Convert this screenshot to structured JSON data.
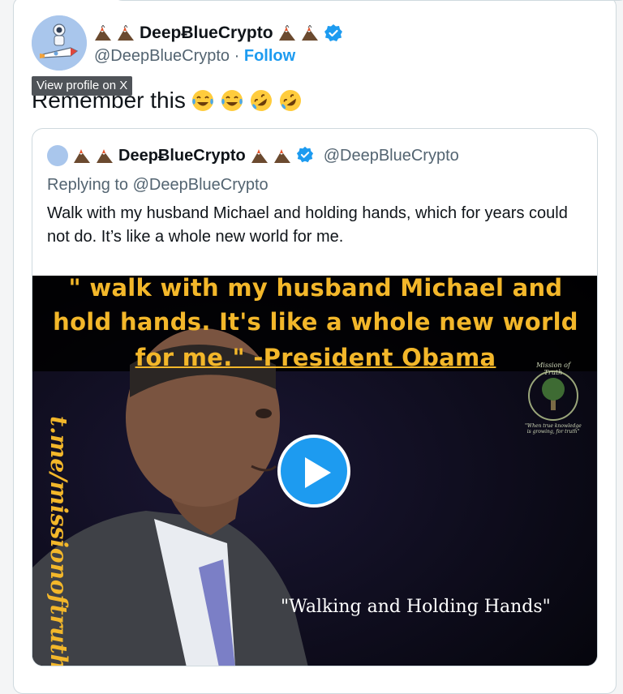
{
  "tweet": {
    "display_name": "DeepɃlueCrypto",
    "handle": "@DeepBlueCrypto",
    "separator": "·",
    "follow_label": "Follow",
    "tooltip": "View profile on X",
    "text": "Remember this",
    "emojis": [
      "tears-of-joy",
      "tears-of-joy",
      "rolling-laughing",
      "rolling-laughing"
    ]
  },
  "quoted": {
    "display_name": "DeepɃlueCrypto",
    "handle": "@DeepBlueCrypto",
    "replying_to": "Replying to @DeepBlueCrypto",
    "text": "Walk with my husband Michael and holding hands, which for years could not do. It’s like a whole new world for me.",
    "video": {
      "caption_line1": "\" walk with my husband Michael and",
      "caption_line2": "hold hands. It's like a whole new world",
      "caption_line3": "for me.\" -President Obama",
      "side_text": "t.me/missionoftruth",
      "bottom_caption": "\"Walking and Holding Hands\"",
      "logo_title": "Mission of Truth",
      "logo_subtitle": "\"When true knowledge is growing, for truth\""
    }
  },
  "colors": {
    "accent": "#1d9bf0",
    "caption": "#f3b72a",
    "muted": "#536471"
  }
}
